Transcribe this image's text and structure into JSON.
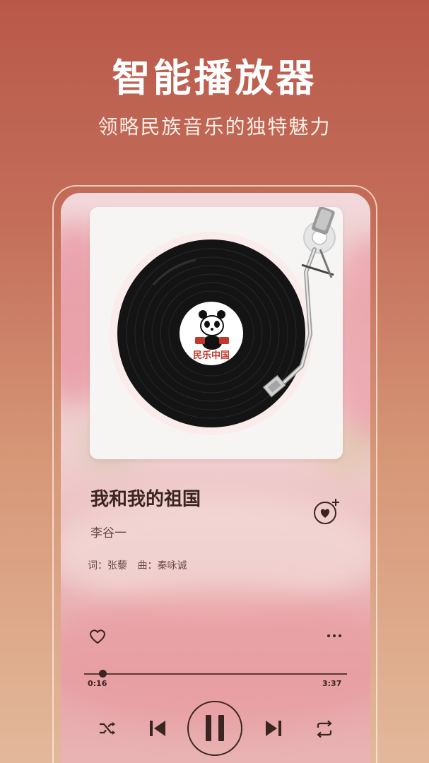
{
  "header": {
    "title": "智能播放器",
    "subtitle": "领略民族音乐的独特魅力"
  },
  "album": {
    "label_text": "民乐中国",
    "icon": "vinyl-record-panda-logo"
  },
  "song": {
    "title": "我和我的祖国",
    "artist": "李谷一",
    "lyricist_label": "词：张藜",
    "composer_label": "曲：秦咏诚"
  },
  "player": {
    "current_time": "0:16",
    "total_time": "3:37",
    "progress": 0.07,
    "state": "playing"
  },
  "icons": {
    "favorite_add": "heart-plus-icon",
    "like": "heart-outline-icon",
    "more": "more-dots-icon",
    "shuffle": "shuffle-icon",
    "previous": "skip-previous-icon",
    "pause": "pause-icon",
    "next": "skip-next-icon",
    "repeat": "repeat-icon"
  },
  "colors": {
    "accent_dark": "#3b2521",
    "label_red": "#c0392b"
  }
}
